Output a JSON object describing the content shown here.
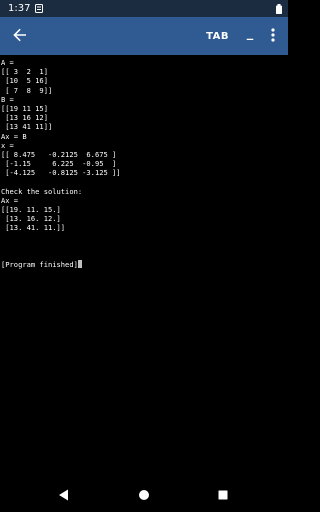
{
  "status": {
    "time": "1:37"
  },
  "toolbar": {
    "tab_label": "TAB",
    "underscore_label": "_"
  },
  "terminal": {
    "lines": [
      "A =",
      "[[ 3  2  1]",
      " [10  5 16]",
      " [ 7  8  9]]",
      "B =",
      "[[19 11 15]",
      " [13 16 12]",
      " [13 41 11]]",
      "Ax = B",
      "x =",
      "[[ 8.475   -0.2125  6.675 ]",
      " [-1.15     6.225  -0.95  ]",
      " [-4.125   -0.8125 -3.125 ]]",
      "",
      "Check the solution:",
      "Ax =",
      "[[19. 11. 15.]",
      " [13. 16. 12.]",
      " [13. 41. 11.]]",
      "",
      "",
      "",
      "[Program finished]"
    ]
  },
  "icons": {
    "status_notification": "notification-icon",
    "status_battery": "battery-icon",
    "back": "arrow-left-icon",
    "more": "more-vert-icon",
    "nav_back": "triangle-back-icon",
    "nav_home": "circle-home-icon",
    "nav_recents": "square-recents-icon"
  },
  "colors": {
    "status_bar": "#1c2c40",
    "app_bar": "#2f5b92",
    "terminal_bg": "#000000",
    "terminal_fg": "#ffffff"
  }
}
